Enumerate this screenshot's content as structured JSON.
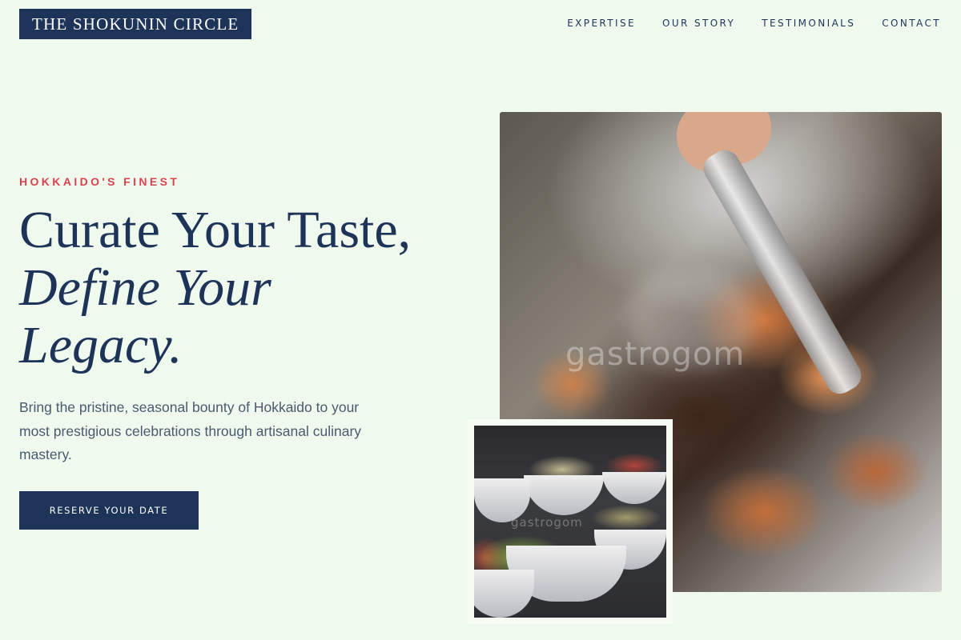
{
  "header": {
    "logo": "THE SHOKUNIN CIRCLE",
    "nav": [
      "EXPERTISE",
      "OUR STORY",
      "TESTIMONIALS",
      "CONTACT"
    ]
  },
  "hero": {
    "eyebrow": "HOKKAIDO'S FINEST",
    "headline_line1": "Curate Your Taste,",
    "headline_line2": "Define Your",
    "headline_line3": "Legacy.",
    "lead": "Bring the pristine, seasonal bounty of Hokkaido to your most prestigious celebrations through artisanal culinary mastery.",
    "cta": "RESERVE YOUR DATE"
  },
  "images": {
    "main_watermark": "gastrogom",
    "inset_watermark": "gastrogom"
  },
  "colors": {
    "background": "#f0f9ee",
    "navy": "#1e3358",
    "accent": "#d9434e"
  }
}
